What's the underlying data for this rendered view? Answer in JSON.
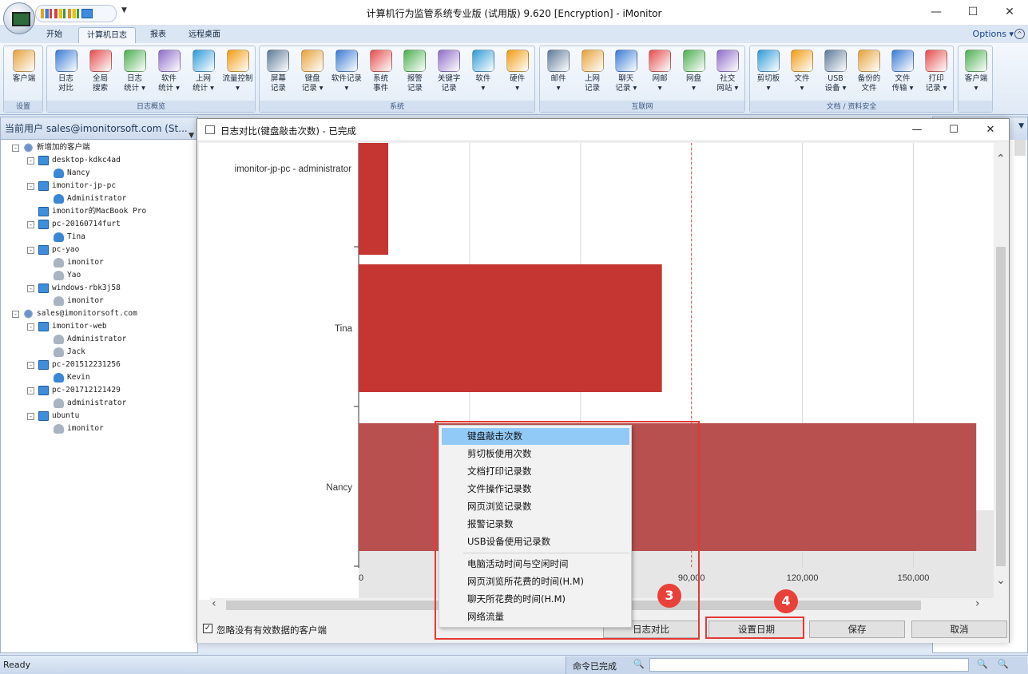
{
  "app": {
    "title": "计算机行为监管系统专业版 (试用版) 9.620 [Encryption] - iMonitor",
    "options_label": "Options ▾"
  },
  "menu_tabs": [
    "开始",
    "计算机日志",
    "报表",
    "远程桌面"
  ],
  "ribbon": {
    "groups": [
      {
        "label": "设置",
        "buttons": [
          [
            "客户端",
            ""
          ]
        ]
      },
      {
        "label": "日志概览",
        "buttons": [
          [
            "日志",
            "对比"
          ],
          [
            "全局",
            "搜索"
          ],
          [
            "日志",
            "统计 ▾"
          ],
          [
            "软件",
            "统计 ▾"
          ],
          [
            "上网",
            "统计 ▾"
          ],
          [
            "流量控制",
            "▾"
          ]
        ]
      },
      {
        "label": "系统",
        "buttons": [
          [
            "屏幕",
            "记录"
          ],
          [
            "键盘",
            "记录 ▾"
          ],
          [
            "软件记录",
            "▾"
          ],
          [
            "系统",
            "事件"
          ],
          [
            "报警",
            "记录"
          ],
          [
            "关键字",
            "记录"
          ],
          [
            "软件",
            "▾"
          ],
          [
            "硬件",
            "▾"
          ]
        ]
      },
      {
        "label": "互联网",
        "buttons": [
          [
            "邮件",
            "▾"
          ],
          [
            "上网",
            "记录"
          ],
          [
            "聊天",
            "记录 ▾"
          ],
          [
            "网邮",
            "▾"
          ],
          [
            "网盘",
            "▾"
          ],
          [
            "社交",
            "网站 ▾"
          ]
        ]
      },
      {
        "label": "文档 / 资料安全",
        "buttons": [
          [
            "剪切板",
            "▾"
          ],
          [
            "文件",
            "▾"
          ],
          [
            "USB",
            "设备 ▾"
          ],
          [
            "备份的",
            "文件"
          ],
          [
            "文件",
            "传输 ▾"
          ],
          [
            "打印",
            "记录 ▾"
          ]
        ]
      },
      {
        "label": "",
        "buttons": [
          [
            "客户端",
            "▾"
          ]
        ]
      }
    ]
  },
  "left_panel": {
    "header": "当前用户 sales@imonitorsoft.com (St...",
    "tree": [
      {
        "level": 0,
        "type": "net",
        "label": "新增加的客户端",
        "exp": "-"
      },
      {
        "level": 1,
        "type": "pc",
        "label": "desktop-kdkc4ad",
        "exp": "-"
      },
      {
        "level": 2,
        "type": "user",
        "label": "Nancy",
        "exp": ""
      },
      {
        "level": 1,
        "type": "pc",
        "label": "imonitor-jp-pc",
        "exp": "-"
      },
      {
        "level": 2,
        "type": "user",
        "label": "Administrator",
        "exp": ""
      },
      {
        "level": 1,
        "type": "pc",
        "label": "imonitor的MacBook Pro",
        "exp": ""
      },
      {
        "level": 1,
        "type": "pc",
        "label": "pc-20160714furt",
        "exp": "-"
      },
      {
        "level": 2,
        "type": "user",
        "label": "Tina",
        "exp": ""
      },
      {
        "level": 1,
        "type": "pc",
        "label": "pc-yao",
        "exp": "-"
      },
      {
        "level": 2,
        "type": "useroff",
        "label": "imonitor",
        "exp": ""
      },
      {
        "level": 2,
        "type": "useroff",
        "label": "Yao",
        "exp": ""
      },
      {
        "level": 1,
        "type": "pc",
        "label": "windows-rbk3j58",
        "exp": "-"
      },
      {
        "level": 2,
        "type": "useroff",
        "label": "imonitor",
        "exp": ""
      },
      {
        "level": 0,
        "type": "net",
        "label": "sales@imonitorsoft.com",
        "exp": "-"
      },
      {
        "level": 1,
        "type": "pc",
        "label": "imonitor-web",
        "exp": "-"
      },
      {
        "level": 2,
        "type": "useroff",
        "label": "Administrator",
        "exp": ""
      },
      {
        "level": 2,
        "type": "useroff",
        "label": "Jack",
        "exp": ""
      },
      {
        "level": 1,
        "type": "pc",
        "label": "pc-201512231256",
        "exp": "-"
      },
      {
        "level": 2,
        "type": "user",
        "label": "Kevin",
        "exp": ""
      },
      {
        "level": 1,
        "type": "pc",
        "label": "pc-201712121429",
        "exp": "-"
      },
      {
        "level": 2,
        "type": "useroff",
        "label": "administrator",
        "exp": ""
      },
      {
        "level": 1,
        "type": "pc",
        "label": "ubuntu",
        "exp": "-"
      },
      {
        "level": 2,
        "type": "useroff",
        "label": "imonitor",
        "exp": ""
      }
    ]
  },
  "dialog": {
    "title": "日志对比(键盘敲击次数) - 已完成",
    "ignore_label": "忽略没有有效数据的客户端",
    "ignore_checked": "✓",
    "buttons": {
      "compare": "日志对比",
      "set_date": "设置日期",
      "save": "保存",
      "cancel": "取消"
    }
  },
  "chart_data": {
    "type": "bar",
    "orientation": "horizontal",
    "categories": [
      "imonitor-jp-pc - administrator",
      "Tina",
      "Nancy"
    ],
    "values": [
      8000,
      82000,
      167000
    ],
    "xlim": [
      0,
      170000
    ],
    "xticks": [
      "0",
      "30,000",
      "60,000",
      "90,000",
      "120,000",
      "150,000"
    ],
    "bar_color": "#c53632",
    "highlight_color": "#b85050"
  },
  "context_menu": {
    "items": [
      "键盘敲击次数",
      "剪切板使用次数",
      "文档打印记录数",
      "文件操作记录数",
      "网页浏览记录数",
      "报警记录数",
      "USB设备使用记录数"
    ],
    "items2": [
      "电脑活动时间与空闲时间",
      "网页浏览所花费的时间(H.M)",
      "聊天所花费的时间(H.M)",
      "网络流量"
    ],
    "selected_index": 0
  },
  "steps": [
    "3",
    "4"
  ],
  "status": {
    "ready": "Ready",
    "command": "命令已完成"
  }
}
